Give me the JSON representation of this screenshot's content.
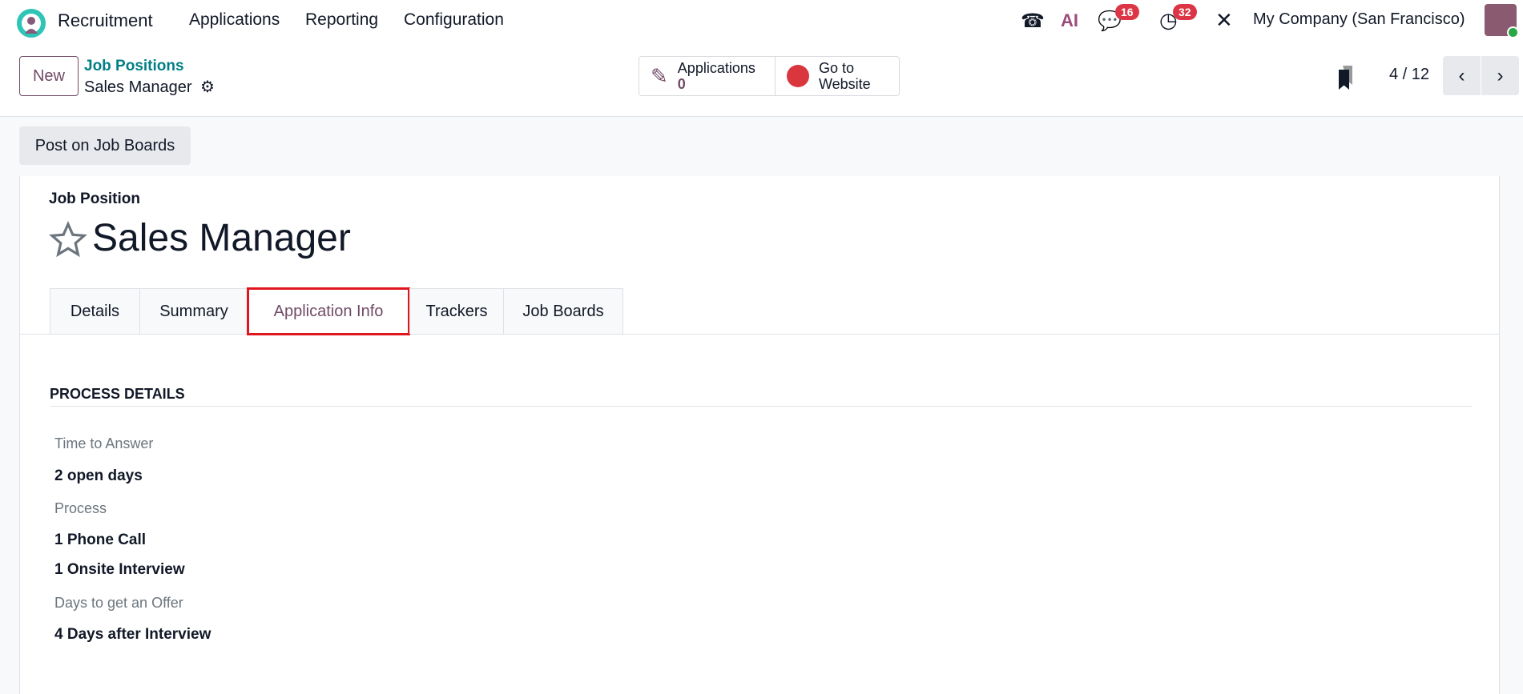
{
  "nav": {
    "app": "Recruitment",
    "menus": [
      "Applications",
      "Reporting",
      "Configuration"
    ],
    "messages_count": "16",
    "activities_count": "32",
    "ai_label": "AI",
    "company": "My Company (San Francisco)"
  },
  "control": {
    "new_label": "New",
    "breadcrumb_parent": "Job Positions",
    "breadcrumb_current": "Sales Manager",
    "smart_applications_label": "Applications",
    "smart_applications_count": "0",
    "smart_website_line1": "Go to",
    "smart_website_line2": "Website",
    "pager": "4 / 12"
  },
  "action": {
    "post_label": "Post on Job Boards"
  },
  "form": {
    "subtitle": "Job Position",
    "title": "Sales Manager",
    "tabs": [
      "Details",
      "Summary",
      "Application Info",
      "Trackers",
      "Job Boards"
    ],
    "active_tab": "Application Info",
    "section": "PROCESS DETAILS",
    "fields": {
      "time_label": "Time to Answer",
      "time_value": "2 open days",
      "process_label": "Process",
      "process_values": [
        "1 Phone Call",
        "1 Onsite Interview"
      ],
      "offer_label": "Days to get an Offer",
      "offer_value": "4 Days after Interview"
    }
  },
  "colors": {
    "brand": "#714b67",
    "link": "#017e84",
    "badge": "#dc3545",
    "highlight": "#e0161e"
  }
}
